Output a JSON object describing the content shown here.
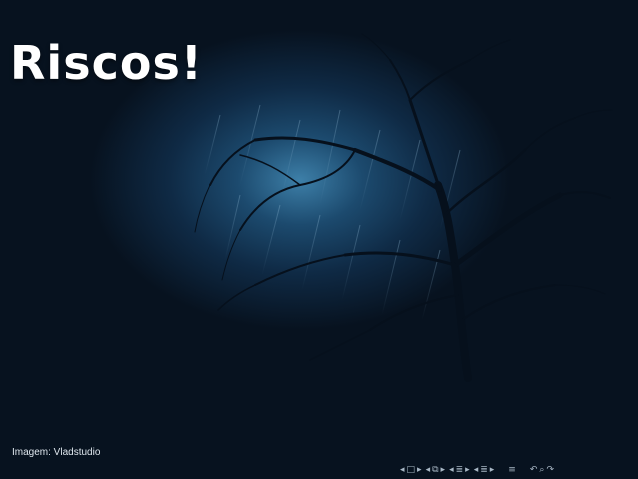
{
  "slide": {
    "title": "Riscos!",
    "caption": "Imagem: Vladstudio"
  },
  "nav": {
    "left": "◂",
    "right": "▸",
    "frame": "□",
    "subsection": "⧉",
    "section": "≣",
    "goto": "≡",
    "back": "↶",
    "search": "⌕",
    "forward": "↷"
  },
  "colors": {
    "background": "#07121f",
    "glow": "#3d7fa8",
    "title": "#ffffff",
    "nav": "#a9b8c6"
  }
}
